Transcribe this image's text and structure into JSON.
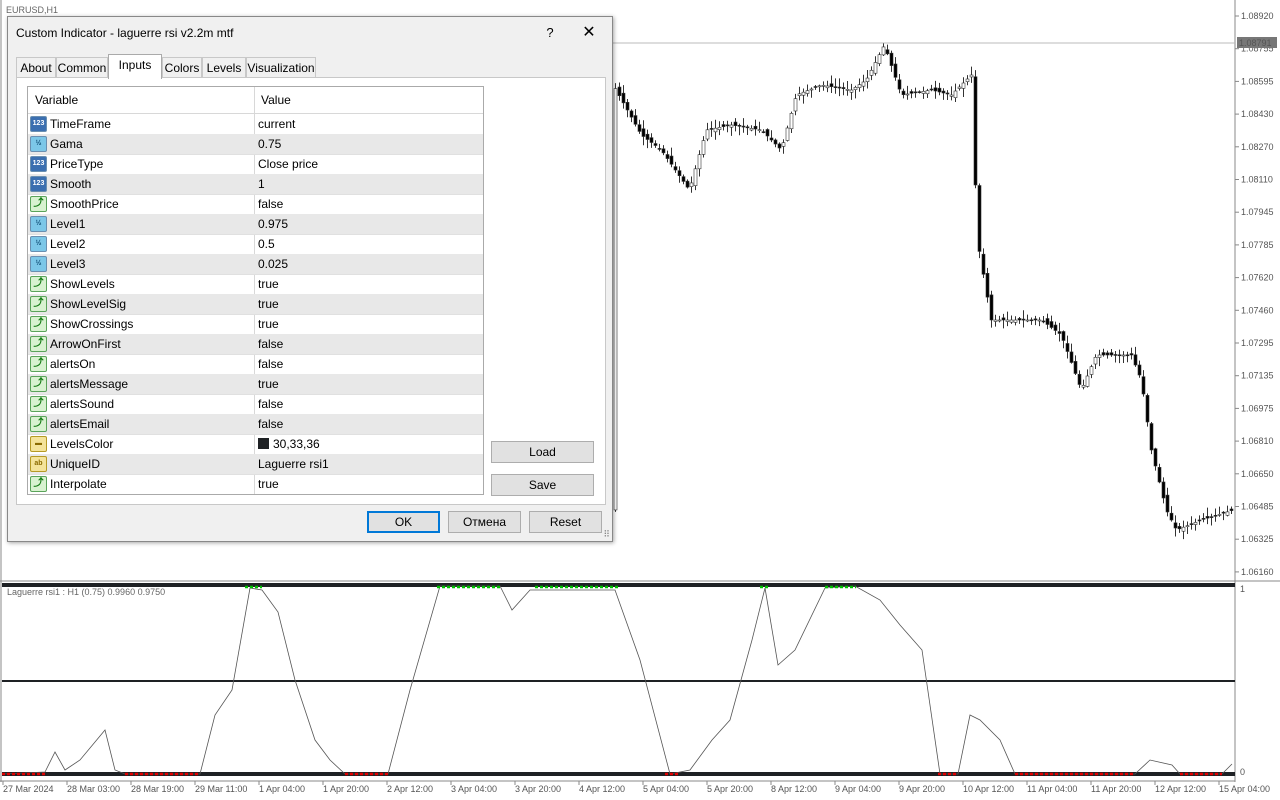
{
  "window": {
    "symbol_label": "EURUSD,H1",
    "price_axis_labels": [
      "1.08920",
      "1.08755",
      "1.08595",
      "1.08430",
      "1.08270",
      "1.08110",
      "1.07945",
      "1.07785",
      "1.07620",
      "1.07460",
      "1.07295",
      "1.07135",
      "1.06975",
      "1.06810",
      "1.06650",
      "1.06485",
      "1.06325",
      "1.06160"
    ],
    "current_price": "1.08791",
    "time_axis_labels": [
      "27 Mar 2024",
      "28 Mar 03:00",
      "28 Mar 19:00",
      "29 Mar 11:00",
      "1 Apr 04:00",
      "1 Apr 20:00",
      "2 Apr 12:00",
      "3 Apr 04:00",
      "3 Apr 20:00",
      "4 Apr 12:00",
      "5 Apr 04:00",
      "5 Apr 20:00",
      "8 Apr 12:00",
      "9 Apr 04:00",
      "9 Apr 20:00",
      "10 Apr 12:00",
      "11 Apr 04:00",
      "11 Apr 20:00",
      "12 Apr 12:00",
      "15 Apr 04:00"
    ],
    "indicator_label": "Laguerre rsi1 : H1 (0.75) 0.9960 0.9750",
    "indicator_scale": [
      "1",
      "0"
    ],
    "colors": {
      "bull": "#ffffff",
      "bear": "#000000",
      "signal_high": "#00c000",
      "signal_low": "#e00000",
      "level": "#1e2124"
    }
  },
  "dialog": {
    "title": "Custom Indicator - laguerre rsi v2.2m mtf",
    "help_label": "?",
    "close_icon": "close-icon",
    "tabs": [
      "About",
      "Common",
      "Inputs",
      "Colors",
      "Levels",
      "Visualization"
    ],
    "active_tab": "Inputs",
    "table": {
      "headers": {
        "variable": "Variable",
        "value": "Value"
      },
      "rows": [
        {
          "type": "int",
          "icon": "int-icon",
          "name": "TimeFrame",
          "value": "current"
        },
        {
          "type": "dbl",
          "icon": "double-icon",
          "name": "Gama",
          "value": "0.75"
        },
        {
          "type": "int",
          "icon": "int-icon",
          "name": "PriceType",
          "value": "Close price"
        },
        {
          "type": "int",
          "icon": "int-icon",
          "name": "Smooth",
          "value": "1"
        },
        {
          "type": "bool",
          "icon": "bool-icon",
          "name": "SmoothPrice",
          "value": "false"
        },
        {
          "type": "dbl",
          "icon": "double-icon",
          "name": "Level1",
          "value": "0.975"
        },
        {
          "type": "dbl",
          "icon": "double-icon",
          "name": "Level2",
          "value": "0.5"
        },
        {
          "type": "dbl",
          "icon": "double-icon",
          "name": "Level3",
          "value": "0.025"
        },
        {
          "type": "bool",
          "icon": "bool-icon",
          "name": "ShowLevels",
          "value": "true"
        },
        {
          "type": "bool",
          "icon": "bool-icon",
          "name": "ShowLevelSig",
          "value": "true"
        },
        {
          "type": "bool",
          "icon": "bool-icon",
          "name": "ShowCrossings",
          "value": "true"
        },
        {
          "type": "bool",
          "icon": "bool-icon",
          "name": "ArrowOnFirst",
          "value": "false"
        },
        {
          "type": "bool",
          "icon": "bool-icon",
          "name": "alertsOn",
          "value": "false"
        },
        {
          "type": "bool",
          "icon": "bool-icon",
          "name": "alertsMessage",
          "value": "true"
        },
        {
          "type": "bool",
          "icon": "bool-icon",
          "name": "alertsSound",
          "value": "false"
        },
        {
          "type": "bool",
          "icon": "bool-icon",
          "name": "alertsEmail",
          "value": "false"
        },
        {
          "type": "color",
          "icon": "color-icon",
          "name": "LevelsColor",
          "value": "30,33,36",
          "swatch": "#1e2124"
        },
        {
          "type": "str",
          "icon": "string-icon",
          "name": "UniqueID",
          "value": "Laguerre rsi1"
        },
        {
          "type": "bool",
          "icon": "bool-icon",
          "name": "Interpolate",
          "value": "true"
        }
      ]
    },
    "buttons": {
      "load": "Load",
      "save": "Save",
      "ok": "OK",
      "cancel": "Отмена",
      "reset": "Reset"
    }
  }
}
